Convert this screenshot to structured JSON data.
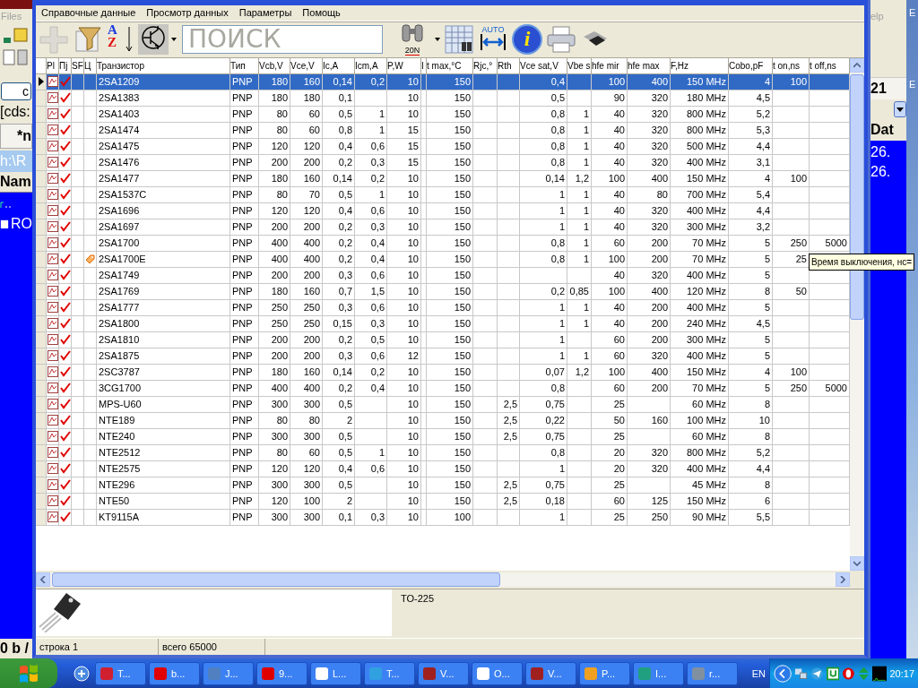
{
  "left_window": {
    "menu_item": "Files",
    "drive_button": "c",
    "path_field": "[cds:",
    "tab": "*n",
    "path_bar": "h:\\R",
    "column_header": "Nam",
    "folder_item": "RO",
    "status_text": "0 b /"
  },
  "right_window": {
    "menu_item": "elp",
    "tab": "21",
    "column_header": "Dat",
    "rows": [
      "26.",
      "26."
    ]
  },
  "desktop_labels": [
    "E",
    "E"
  ],
  "menu": [
    "Справочные данные",
    "Просмотр данных",
    "Параметры",
    "Помощь"
  ],
  "toolbar": {
    "search": {
      "placeholder": "ПОИСК"
    },
    "sort_letters": [
      "A",
      "Z"
    ],
    "find_badge": "20N",
    "autofit_badge": "AUTO",
    "info_letter": "i"
  },
  "grid": {
    "icon_columns": [
      "Pl",
      "Пј",
      "SF",
      "Ц"
    ],
    "columns": [
      "Транзистор",
      "Тип",
      "Vcb,V",
      "Vce,V",
      "Ic,A",
      "Icm,A",
      "P,W",
      "I",
      "t max,°C",
      "Rjc,°",
      "Rth",
      "Vce sat,V",
      "Vbe s",
      "hfe mir",
      "hfe max",
      "F,Hz",
      "Cobo,pF",
      "t on,ns",
      "t off,ns"
    ],
    "rows": [
      {
        "selected": true,
        "checked": true,
        "tag": false,
        "cells": [
          "2SA1209",
          "PNP",
          "180",
          "160",
          "0,14",
          "0,2",
          "10",
          null,
          "150",
          null,
          null,
          "0,4",
          null,
          "100",
          "400",
          "150 MHz",
          "4",
          "100",
          null
        ]
      },
      {
        "selected": false,
        "checked": true,
        "tag": false,
        "cells": [
          "2SA1383",
          "PNP",
          "180",
          "180",
          "0,1",
          null,
          "10",
          null,
          "150",
          null,
          null,
          "0,5",
          null,
          "90",
          "320",
          "180 MHz",
          "4,5",
          null,
          null
        ]
      },
      {
        "selected": false,
        "checked": true,
        "tag": false,
        "cells": [
          "2SA1403",
          "PNP",
          "80",
          "60",
          "0,5",
          "1",
          "10",
          null,
          "150",
          null,
          null,
          "0,8",
          "1",
          "40",
          "320",
          "800 MHz",
          "5,2",
          null,
          null
        ]
      },
      {
        "selected": false,
        "checked": true,
        "tag": false,
        "cells": [
          "2SA1474",
          "PNP",
          "80",
          "60",
          "0,8",
          "1",
          "15",
          null,
          "150",
          null,
          null,
          "0,8",
          "1",
          "40",
          "320",
          "800 MHz",
          "5,3",
          null,
          null
        ]
      },
      {
        "selected": false,
        "checked": true,
        "tag": false,
        "cells": [
          "2SA1475",
          "PNP",
          "120",
          "120",
          "0,4",
          "0,6",
          "15",
          null,
          "150",
          null,
          null,
          "0,8",
          "1",
          "40",
          "320",
          "500 MHz",
          "4,4",
          null,
          null
        ]
      },
      {
        "selected": false,
        "checked": true,
        "tag": false,
        "cells": [
          "2SA1476",
          "PNP",
          "200",
          "200",
          "0,2",
          "0,3",
          "15",
          null,
          "150",
          null,
          null,
          "0,8",
          "1",
          "40",
          "320",
          "400 MHz",
          "3,1",
          null,
          null
        ]
      },
      {
        "selected": false,
        "checked": true,
        "tag": false,
        "cells": [
          "2SA1477",
          "PNP",
          "180",
          "160",
          "0,14",
          "0,2",
          "10",
          null,
          "150",
          null,
          null,
          "0,14",
          "1,2",
          "100",
          "400",
          "150 MHz",
          "4",
          "100",
          null
        ]
      },
      {
        "selected": false,
        "checked": true,
        "tag": false,
        "cells": [
          "2SA1537C",
          "PNP",
          "80",
          "70",
          "0,5",
          "1",
          "10",
          null,
          "150",
          null,
          null,
          "1",
          "1",
          "40",
          "80",
          "700 MHz",
          "5,4",
          null,
          null
        ]
      },
      {
        "selected": false,
        "checked": true,
        "tag": false,
        "cells": [
          "2SA1696",
          "PNP",
          "120",
          "120",
          "0,4",
          "0,6",
          "10",
          null,
          "150",
          null,
          null,
          "1",
          "1",
          "40",
          "320",
          "400 MHz",
          "4,4",
          null,
          null
        ]
      },
      {
        "selected": false,
        "checked": true,
        "tag": false,
        "cells": [
          "2SA1697",
          "PNP",
          "200",
          "200",
          "0,2",
          "0,3",
          "10",
          null,
          "150",
          null,
          null,
          "1",
          "1",
          "40",
          "320",
          "300 MHz",
          "3,2",
          null,
          null
        ]
      },
      {
        "selected": false,
        "checked": true,
        "tag": false,
        "cells": [
          "2SA1700",
          "PNP",
          "400",
          "400",
          "0,2",
          "0,4",
          "10",
          null,
          "150",
          null,
          null,
          "0,8",
          "1",
          "60",
          "200",
          "70 MHz",
          "5",
          "250",
          "5000"
        ]
      },
      {
        "selected": false,
        "checked": true,
        "tag": true,
        "cells": [
          "2SA1700E",
          "PNP",
          "400",
          "400",
          "0,2",
          "0,4",
          "10",
          null,
          "150",
          null,
          null,
          "0,8",
          "1",
          "100",
          "200",
          "70 MHz",
          "5",
          "25",
          null
        ]
      },
      {
        "selected": false,
        "checked": true,
        "tag": false,
        "cells": [
          "2SA1749",
          "PNP",
          "200",
          "200",
          "0,3",
          "0,6",
          "10",
          null,
          "150",
          null,
          null,
          null,
          null,
          "40",
          "320",
          "400 MHz",
          "5",
          null,
          null
        ]
      },
      {
        "selected": false,
        "checked": true,
        "tag": false,
        "cells": [
          "2SA1769",
          "PNP",
          "180",
          "160",
          "0,7",
          "1,5",
          "10",
          null,
          "150",
          null,
          null,
          "0,2",
          "0,85",
          "100",
          "400",
          "120 MHz",
          "8",
          "50",
          null
        ]
      },
      {
        "selected": false,
        "checked": true,
        "tag": false,
        "cells": [
          "2SA1777",
          "PNP",
          "250",
          "250",
          "0,3",
          "0,6",
          "10",
          null,
          "150",
          null,
          null,
          "1",
          "1",
          "40",
          "200",
          "400 MHz",
          "5",
          null,
          null
        ]
      },
      {
        "selected": false,
        "checked": true,
        "tag": false,
        "cells": [
          "2SA1800",
          "PNP",
          "250",
          "250",
          "0,15",
          "0,3",
          "10",
          null,
          "150",
          null,
          null,
          "1",
          "1",
          "40",
          "200",
          "240 MHz",
          "4,5",
          null,
          null
        ]
      },
      {
        "selected": false,
        "checked": true,
        "tag": false,
        "cells": [
          "2SA1810",
          "PNP",
          "200",
          "200",
          "0,2",
          "0,5",
          "10",
          null,
          "150",
          null,
          null,
          "1",
          null,
          "60",
          "200",
          "300 MHz",
          "5",
          null,
          null
        ]
      },
      {
        "selected": false,
        "checked": true,
        "tag": false,
        "cells": [
          "2SA1875",
          "PNP",
          "200",
          "200",
          "0,3",
          "0,6",
          "12",
          null,
          "150",
          null,
          null,
          "1",
          "1",
          "60",
          "320",
          "400 MHz",
          "5",
          null,
          null
        ]
      },
      {
        "selected": false,
        "checked": true,
        "tag": false,
        "cells": [
          "2SC3787",
          "PNP",
          "180",
          "160",
          "0,14",
          "0,2",
          "10",
          null,
          "150",
          null,
          null,
          "0,07",
          "1,2",
          "100",
          "400",
          "150 MHz",
          "4",
          "100",
          null
        ]
      },
      {
        "selected": false,
        "checked": true,
        "tag": false,
        "cells": [
          "3CG1700",
          "PNP",
          "400",
          "400",
          "0,2",
          "0,4",
          "10",
          null,
          "150",
          null,
          null,
          "0,8",
          null,
          "60",
          "200",
          "70 MHz",
          "5",
          "250",
          "5000"
        ]
      },
      {
        "selected": false,
        "checked": true,
        "tag": false,
        "cells": [
          "MPS-U60",
          "PNP",
          "300",
          "300",
          "0,5",
          null,
          "10",
          null,
          "150",
          null,
          "2,5",
          "0,75",
          null,
          "25",
          null,
          "60 MHz",
          "8",
          null,
          null
        ]
      },
      {
        "selected": false,
        "checked": true,
        "tag": false,
        "cells": [
          "NTE189",
          "PNP",
          "80",
          "80",
          "2",
          null,
          "10",
          null,
          "150",
          null,
          "2,5",
          "0,22",
          null,
          "50",
          "160",
          "100 MHz",
          "10",
          null,
          null
        ]
      },
      {
        "selected": false,
        "checked": true,
        "tag": false,
        "cells": [
          "NTE240",
          "PNP",
          "300",
          "300",
          "0,5",
          null,
          "10",
          null,
          "150",
          null,
          "2,5",
          "0,75",
          null,
          "25",
          null,
          "60 MHz",
          "8",
          null,
          null
        ]
      },
      {
        "selected": false,
        "checked": true,
        "tag": false,
        "cells": [
          "NTE2512",
          "PNP",
          "80",
          "60",
          "0,5",
          "1",
          "10",
          null,
          "150",
          null,
          null,
          "0,8",
          null,
          "20",
          "320",
          "800 MHz",
          "5,2",
          null,
          null
        ]
      },
      {
        "selected": false,
        "checked": true,
        "tag": false,
        "cells": [
          "NTE2575",
          "PNP",
          "120",
          "120",
          "0,4",
          "0,6",
          "10",
          null,
          "150",
          null,
          null,
          "1",
          null,
          "20",
          "320",
          "400 MHz",
          "4,4",
          null,
          null
        ]
      },
      {
        "selected": false,
        "checked": true,
        "tag": false,
        "cells": [
          "NTE296",
          "PNP",
          "300",
          "300",
          "0,5",
          null,
          "10",
          null,
          "150",
          null,
          "2,5",
          "0,75",
          null,
          "25",
          null,
          "45 MHz",
          "8",
          null,
          null
        ]
      },
      {
        "selected": false,
        "checked": true,
        "tag": false,
        "cells": [
          "NTE50",
          "PNP",
          "120",
          "100",
          "2",
          null,
          "10",
          null,
          "150",
          null,
          "2,5",
          "0,18",
          null,
          "60",
          "125",
          "150 MHz",
          "6",
          null,
          null
        ]
      },
      {
        "selected": false,
        "checked": true,
        "tag": false,
        "cells": [
          "KT9115A",
          "PNP",
          "300",
          "300",
          "0,1",
          "0,3",
          "10",
          null,
          "100",
          null,
          null,
          "1",
          null,
          "25",
          "250",
          "90 MHz",
          "5,5",
          null,
          null
        ]
      }
    ]
  },
  "tooltip": "Время выключения, нс=",
  "preview": {
    "package": "TO-225"
  },
  "status_bar": [
    "строка 1",
    "всего 65000"
  ],
  "taskbar": {
    "buttons": [
      "T...",
      "b...",
      "J...",
      "9...",
      "L...",
      "T...",
      "V...",
      "O...",
      "V...",
      "P...",
      "I...",
      "r..."
    ],
    "language": "EN",
    "clock": "20:17"
  }
}
